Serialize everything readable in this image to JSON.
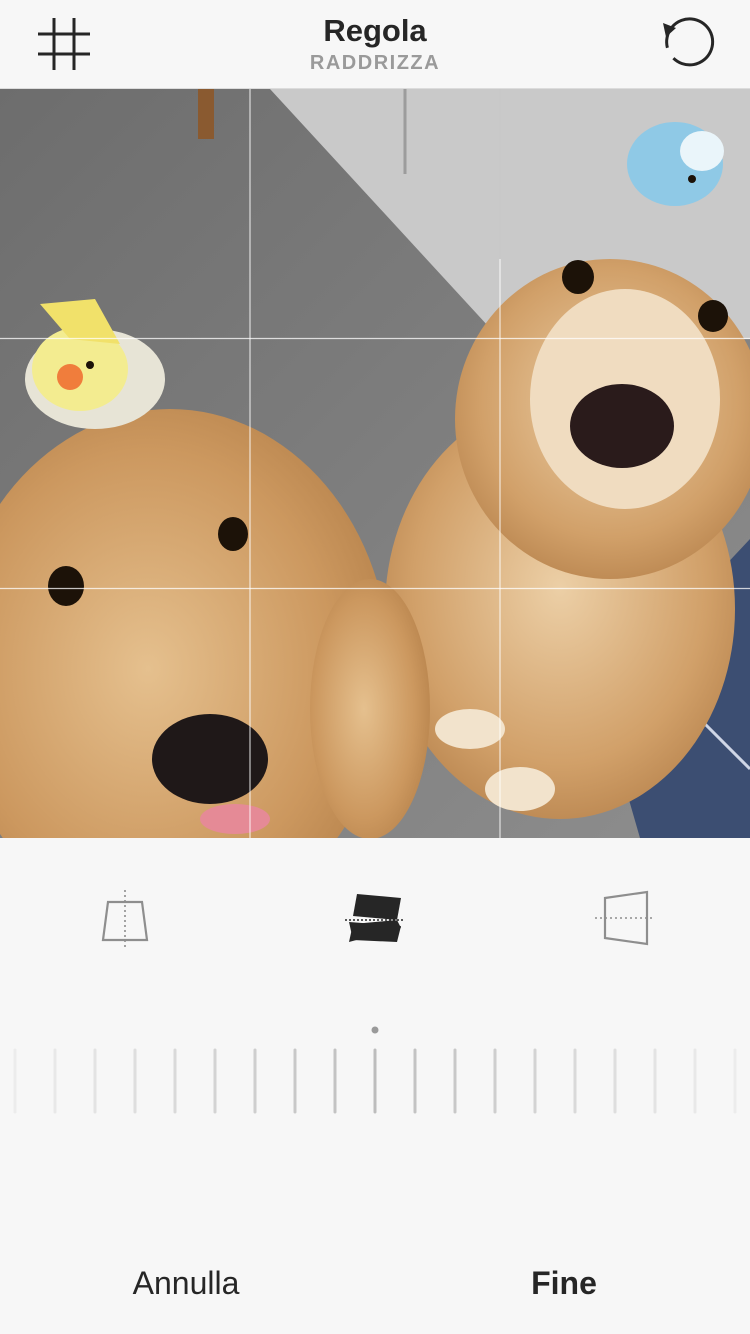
{
  "header": {
    "title": "Regola",
    "subtitle": "RADDRIZZA",
    "grid_icon": "grid-icon",
    "reset_icon": "rotate-reset-icon"
  },
  "photo": {
    "description_icon": "photo-preview",
    "grid_overlay": true
  },
  "modes": [
    {
      "name": "vertical-perspective-icon",
      "active": false
    },
    {
      "name": "straighten-icon",
      "active": true
    },
    {
      "name": "horizontal-perspective-icon",
      "active": false
    }
  ],
  "dial": {
    "value": 0
  },
  "footer": {
    "cancel_label": "Annulla",
    "done_label": "Fine"
  },
  "colors": {
    "background": "#f7f7f7",
    "text": "#262626",
    "subtitle": "#9a9a9a",
    "inactive_icon": "#8e8e8e"
  }
}
